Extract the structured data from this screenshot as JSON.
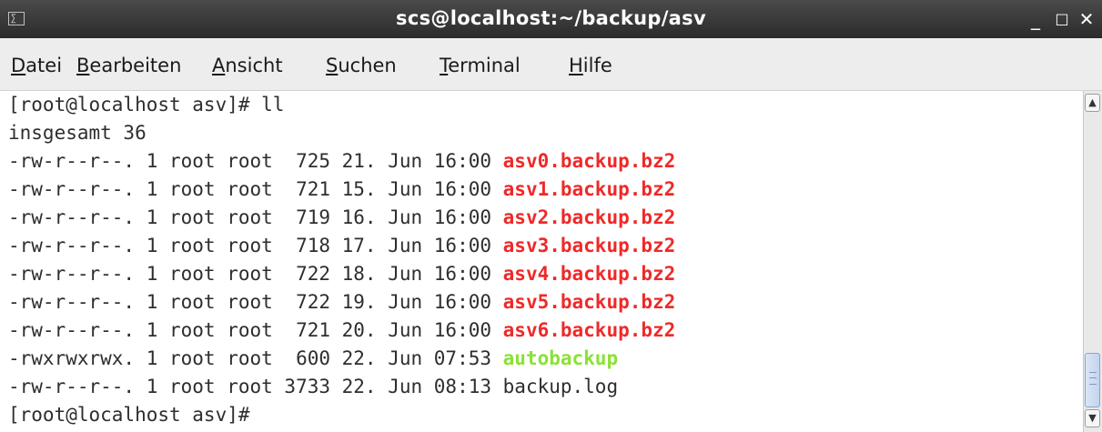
{
  "window": {
    "title": "scs@localhost:~/backup/asv",
    "icon": "terminal-icon",
    "icon_glyph": "∑",
    "buttons": {
      "minimize": "_",
      "maximize": "□",
      "close": "✕"
    }
  },
  "menu": {
    "items": [
      {
        "mnemonic": "D",
        "rest": "atei"
      },
      {
        "mnemonic": "B",
        "rest": "earbeiten"
      },
      {
        "mnemonic": "A",
        "rest": "nsicht"
      },
      {
        "mnemonic": "S",
        "rest": "uchen"
      },
      {
        "mnemonic": "T",
        "rest": "erminal"
      },
      {
        "mnemonic": "H",
        "rest": "ilfe"
      }
    ]
  },
  "terminal": {
    "prompt_cmd": "[root@localhost asv]# ll",
    "total": "insgesamt 36",
    "files": [
      {
        "meta": "-rw-r--r--. 1 root root  725 21. Jun 16:00 ",
        "name": "asv0.backup.bz2"
      },
      {
        "meta": "-rw-r--r--. 1 root root  721 15. Jun 16:00 ",
        "name": "asv1.backup.bz2"
      },
      {
        "meta": "-rw-r--r--. 1 root root  719 16. Jun 16:00 ",
        "name": "asv2.backup.bz2"
      },
      {
        "meta": "-rw-r--r--. 1 root root  718 17. Jun 16:00 ",
        "name": "asv3.backup.bz2"
      },
      {
        "meta": "-rw-r--r--. 1 root root  722 18. Jun 16:00 ",
        "name": "asv4.backup.bz2"
      },
      {
        "meta": "-rw-r--r--. 1 root root  722 19. Jun 16:00 ",
        "name": "asv5.backup.bz2"
      },
      {
        "meta": "-rw-r--r--. 1 root root  721 20. Jun 16:00 ",
        "name": "asv6.backup.bz2"
      },
      {
        "meta": "-rwxrwxrwx. 1 root root  600 22. Jun 07:53 ",
        "name": "autobackup"
      },
      {
        "meta": "-rw-r--r--. 1 root root 3733 22. Jun 08:13 ",
        "name": "backup.log"
      }
    ],
    "prompt_end": "[root@localhost asv]# "
  },
  "colors": {
    "archive": "#ef2929",
    "executable": "#8ae234",
    "text": "#2e2e2e"
  },
  "scrollbar": {
    "up_icon": "▲",
    "down_icon": "▼"
  }
}
